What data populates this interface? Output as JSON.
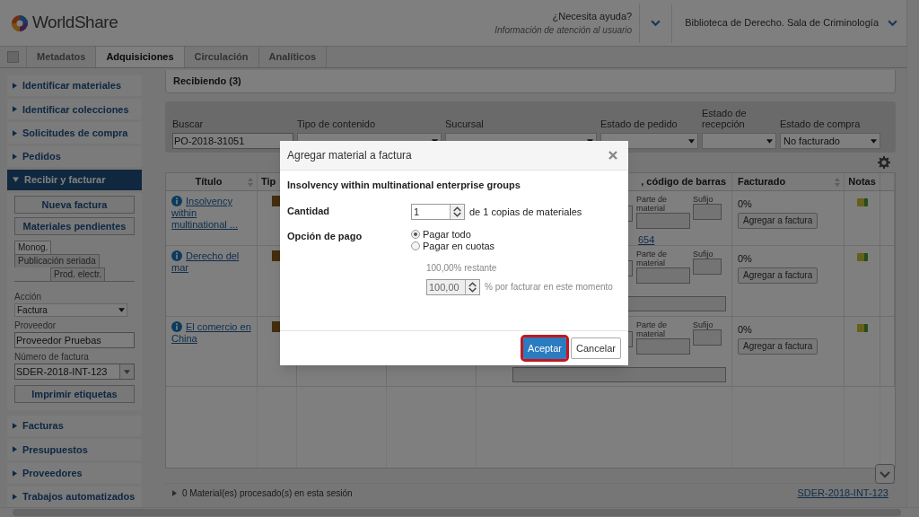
{
  "header": {
    "logo": "WorldShare",
    "help": {
      "label": "¿Necesita ayuda?",
      "sub": "Información de atención al usuario"
    },
    "institution": "Biblioteca de Derecho. Sala de Criminología"
  },
  "nav_tabs": [
    {
      "label": "Metadatos",
      "selected": false
    },
    {
      "label": "Adquisiciones",
      "selected": true
    },
    {
      "label": "Circulación",
      "selected": false
    },
    {
      "label": "Analíticos",
      "selected": false
    }
  ],
  "sidebar": {
    "items": [
      {
        "label": "Identificar materiales",
        "expanded": false
      },
      {
        "label": "Identificar colecciones",
        "expanded": false
      },
      {
        "label": "Solicitudes de compra",
        "expanded": false
      },
      {
        "label": "Pedidos",
        "expanded": false
      },
      {
        "label": "Recibir y facturar",
        "expanded": true
      },
      {
        "label": "Facturas",
        "expanded": false
      },
      {
        "label": "Presupuestos",
        "expanded": false
      },
      {
        "label": "Proveedores",
        "expanded": false
      },
      {
        "label": "Trabajos automatizados",
        "expanded": false
      }
    ],
    "panel": {
      "buttons": [
        "Nueva factura",
        "Materiales pendientes"
      ],
      "subtabs": [
        {
          "label": "Monog.",
          "selected": true
        },
        {
          "label": "Publicación seriada",
          "selected": false
        },
        {
          "label": "Prod. electr.",
          "selected": false
        }
      ],
      "fields": [
        {
          "label": "Acción",
          "kind": "select",
          "value": "Factura"
        },
        {
          "label": "Proveedor",
          "kind": "text",
          "value": "Proveedor Pruebas"
        },
        {
          "label": "Número de factura",
          "kind": "combo",
          "value": "SDER-2018-INT-123"
        }
      ],
      "print_button": "Imprimir etiquetas"
    }
  },
  "content": {
    "section_title": "Recibiendo (3)",
    "filters": [
      {
        "label": "Buscar",
        "kind": "text",
        "value": "PO-2018-31051"
      },
      {
        "label": "Tipo de contenido",
        "kind": "select"
      },
      {
        "label": "Sucursal",
        "kind": "select"
      },
      {
        "label": "Estado de pedido",
        "kind": "select"
      },
      {
        "label": "Estado de recepción",
        "kind": "select"
      },
      {
        "label": "Estado de compra",
        "kind": "select",
        "value": "No facturado"
      }
    ],
    "table": {
      "columns": [
        {
          "label": "Título",
          "sortable": true
        },
        {
          "label": "Tip"
        },
        {
          "label": ", código de barras"
        },
        {
          "label": "Facturado",
          "sortable": true
        },
        {
          "label": "Notas"
        }
      ],
      "rows": [
        {
          "title": "Insolvency within multinational ...",
          "part_label": "Parte de material",
          "suffix_label": "Sufijo",
          "barcode_link": "654",
          "billed": "0%",
          "action": "Agregar a factura"
        },
        {
          "title": "Derecho del mar",
          "part_label": "Parte de material",
          "suffix_label": "Sufijo",
          "billed": "0%",
          "action": "Agregar a factura"
        },
        {
          "title": "El comercio en China",
          "part_label": "Parte de material",
          "suffix_label": "Sufijo",
          "billed": "0%",
          "action": "Agregar a factura"
        }
      ]
    },
    "footer": {
      "summary": "0 Material(es) procesado(s) en esta sesión",
      "invoice_link": "SDER-2018-INT-123"
    }
  },
  "modal": {
    "title": "Agregar material a factura",
    "item_title": "Insolvency within multinational enterprise groups",
    "quantity": {
      "label": "Cantidad",
      "value": "1",
      "suffix": "de 1 copias de materiales"
    },
    "payment": {
      "label": "Opción de pago",
      "options": [
        {
          "label": "Pagar todo",
          "selected": true
        },
        {
          "label": "Pagar en cuotas",
          "selected": false
        }
      ],
      "remaining": "100,00% restante",
      "percent": {
        "value": "100,00",
        "suffix": "% por facturar en este momento",
        "disabled": true
      }
    },
    "buttons": [
      {
        "label": "Aceptar",
        "kind": "primary",
        "focused": true
      },
      {
        "label": "Cancelar",
        "kind": "secondary",
        "focused": false
      }
    ]
  }
}
